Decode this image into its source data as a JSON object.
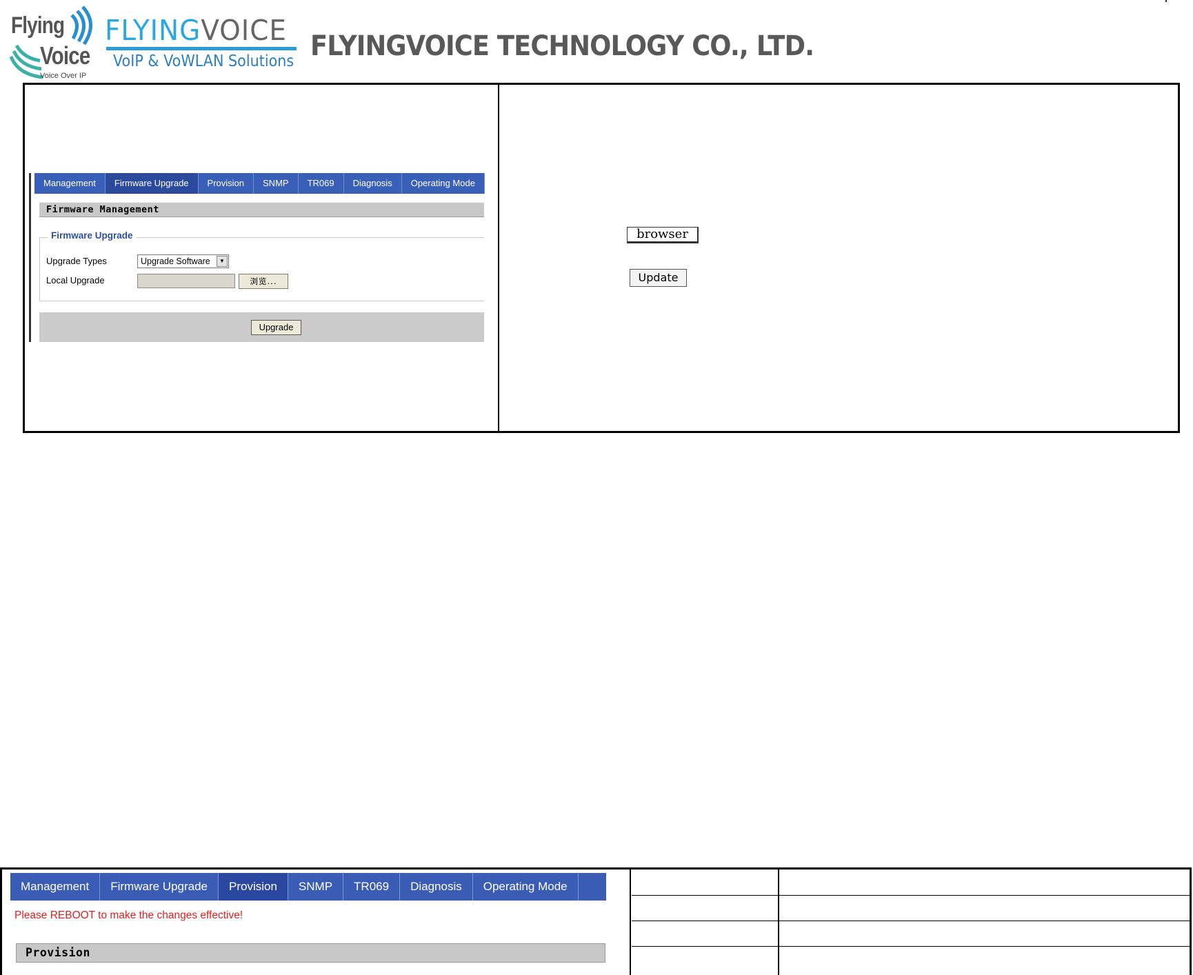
{
  "header": {
    "logo1": {
      "line1": "Flying",
      "line2": "Voice",
      "tagline": "Voice Over IP"
    },
    "logo2": {
      "part_a": "FLYING",
      "part_b": "VOICE",
      "subtitle": "VoIP & VoWLAN Solutions"
    },
    "company": "FLYINGVOICE TECHNOLOGY CO., LTD."
  },
  "firmware_screenshot": {
    "tabs": [
      {
        "label": "Management",
        "active": false
      },
      {
        "label": "Firmware Upgrade",
        "active": true
      },
      {
        "label": "Provision",
        "active": false
      },
      {
        "label": "SNMP",
        "active": false
      },
      {
        "label": "TR069",
        "active": false
      },
      {
        "label": "Diagnosis",
        "active": false
      },
      {
        "label": "Operating Mode",
        "active": false
      }
    ],
    "section_title": "Firmware Management",
    "fieldset_legend": "Firmware Upgrade",
    "upgrade_types_label": "Upgrade Types",
    "upgrade_types_value": "Upgrade Software",
    "local_upgrade_label": "Local Upgrade",
    "browse_label": "浏览...",
    "upgrade_button": "Upgrade"
  },
  "right_cell": {
    "browser_button": "browser",
    "update_button": "Update"
  },
  "provision_screenshot": {
    "tabs": [
      {
        "label": "Management",
        "active": false
      },
      {
        "label": "Firmware Upgrade",
        "active": false
      },
      {
        "label": "Provision",
        "active": true
      },
      {
        "label": "SNMP",
        "active": false
      },
      {
        "label": "TR069",
        "active": false
      },
      {
        "label": "Diagnosis",
        "active": false
      },
      {
        "label": "Operating Mode",
        "active": false
      }
    ],
    "reboot_notice": "Please REBOOT to make the changes effective!",
    "section_title": "Provision"
  },
  "colors": {
    "tab_bar": "#3a5fb8",
    "tab_active": "#2b4a9e",
    "legend": "#2c4f9a",
    "notice": "#e32020",
    "logo_blue": "#29a8e0",
    "company_text": "#595959"
  }
}
